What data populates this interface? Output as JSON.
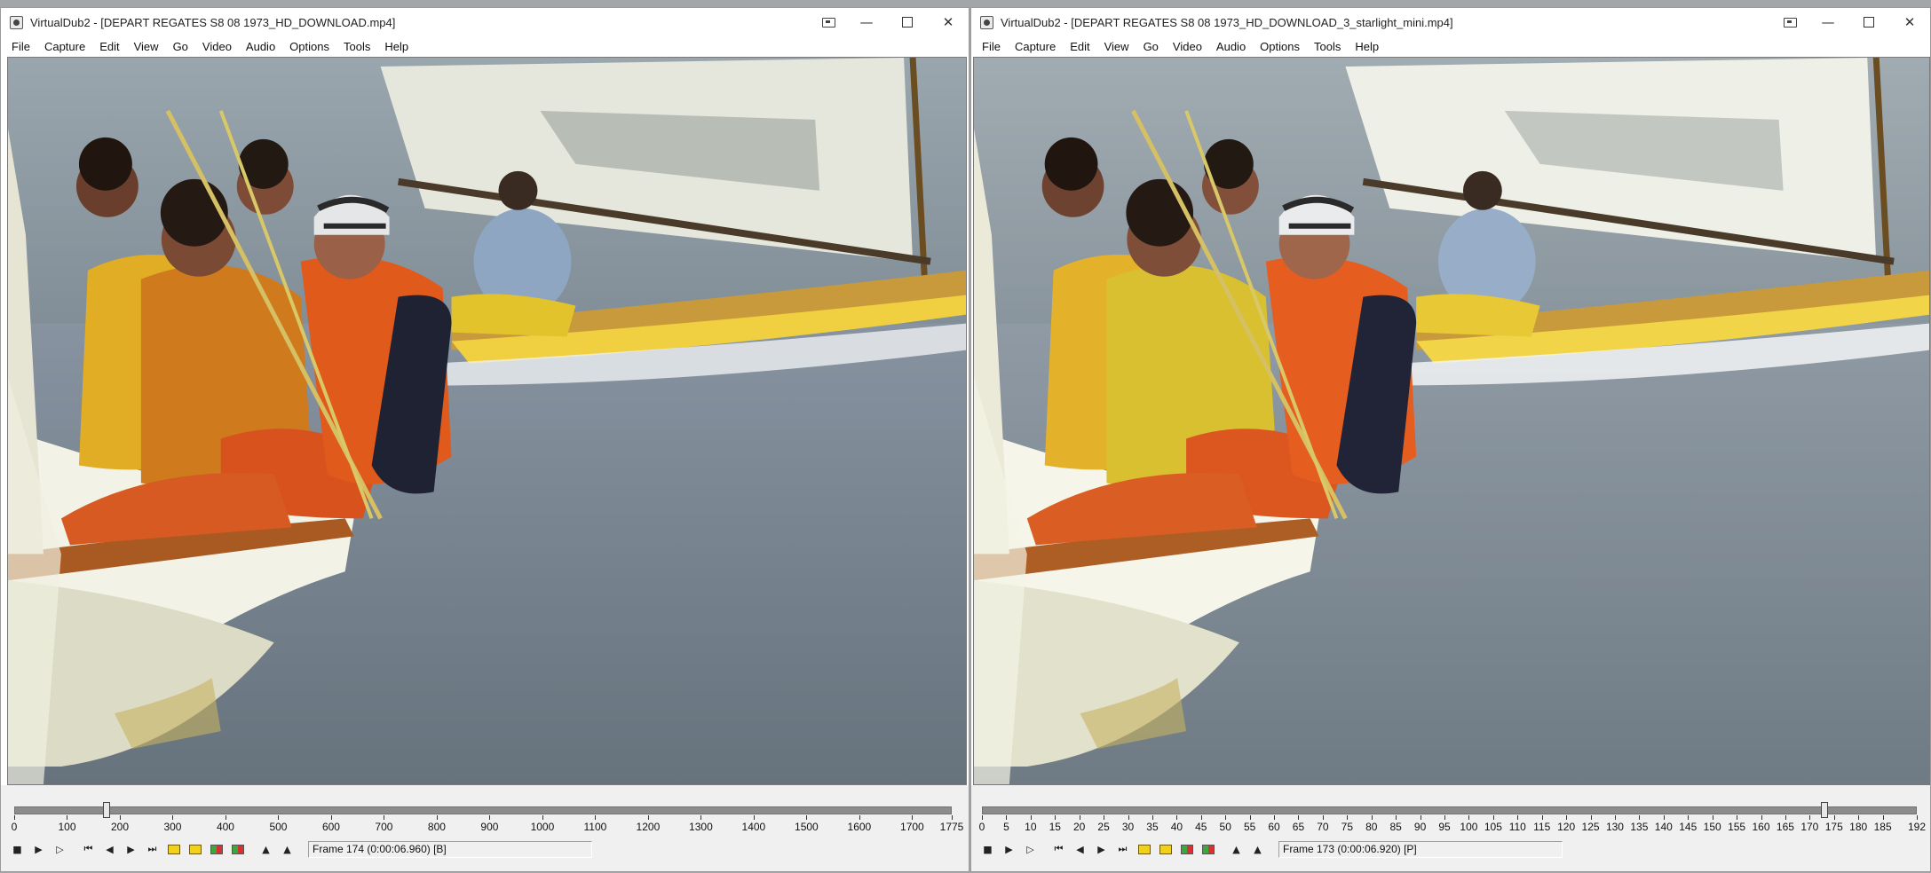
{
  "windows": {
    "left": {
      "app_name": "VirtualDub2",
      "title": "VirtualDub2  - [DEPART REGATES S8 08 1973_HD_DOWNLOAD.mp4]",
      "menu": [
        "File",
        "Capture",
        "Edit",
        "View",
        "Go",
        "Video",
        "Audio",
        "Options",
        "Tools",
        "Help"
      ],
      "timeline": {
        "min": 0,
        "max": 1775,
        "position": 174,
        "ticks": [
          "0",
          "100",
          "200",
          "300",
          "400",
          "500",
          "600",
          "700",
          "800",
          "900",
          "1000",
          "1100",
          "1200",
          "1300",
          "1400",
          "1500",
          "1600",
          "1700",
          "1775"
        ]
      },
      "status": "Frame 174 (0:00:06.960) [B]"
    },
    "right": {
      "app_name": "VirtualDub2",
      "title": "VirtualDub2  - [DEPART REGATES S8 08 1973_HD_DOWNLOAD_3_starlight_mini.mp4]",
      "menu": [
        "File",
        "Capture",
        "Edit",
        "View",
        "Go",
        "Video",
        "Audio",
        "Options",
        "Tools",
        "Help"
      ],
      "timeline": {
        "min": 0,
        "max": 192,
        "position": 173,
        "ticks": [
          "0",
          "5",
          "10",
          "15",
          "20",
          "25",
          "30",
          "35",
          "40",
          "45",
          "50",
          "55",
          "60",
          "65",
          "70",
          "75",
          "80",
          "85",
          "90",
          "95",
          "100",
          "105",
          "110",
          "115",
          "120",
          "125",
          "130",
          "135",
          "140",
          "145",
          "150",
          "155",
          "160",
          "165",
          "170",
          "175",
          "180",
          "185",
          "192"
        ]
      },
      "status": "Frame 173 (0:00:06.920) [P]"
    }
  },
  "toolbar_icons": [
    "stop-icon",
    "play-input-icon",
    "play-output-icon",
    "go-start-icon",
    "prev-frame-icon",
    "next-frame-icon",
    "go-end-icon",
    "prev-key-icon",
    "next-key-icon",
    "scene-back-icon",
    "scene-forward-icon",
    "mark-in-icon",
    "mark-out-icon"
  ],
  "colors": {
    "accent_sail": "#e8d98a",
    "orange_jacket": "#d8521e",
    "yellow_jacket": "#e6b322",
    "water": "#7c8891",
    "desktop": "#a3a6a9"
  }
}
